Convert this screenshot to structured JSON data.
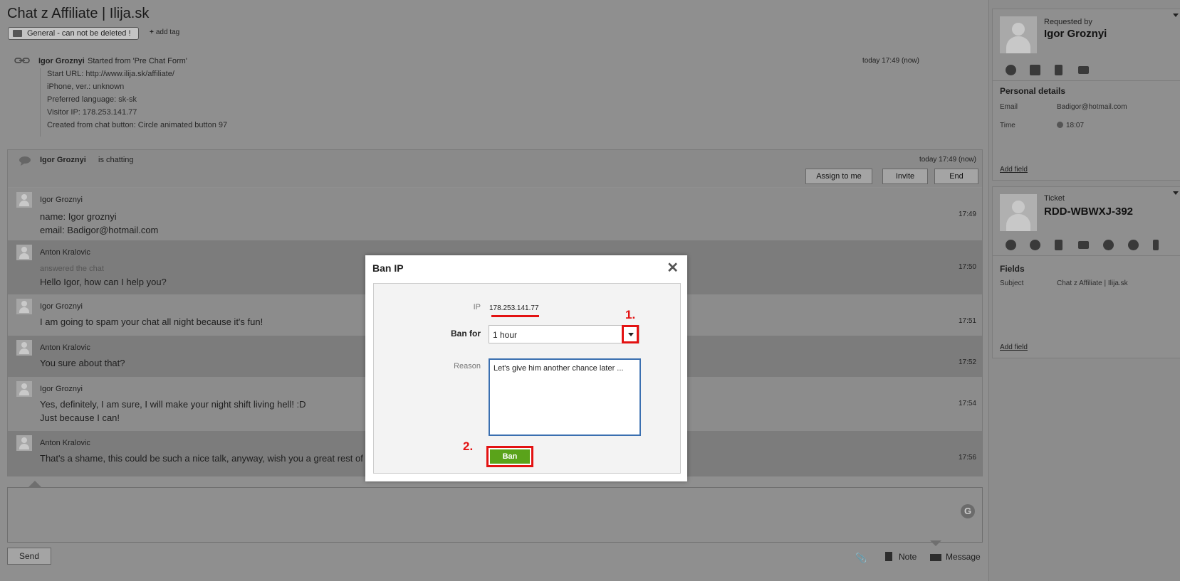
{
  "header": {
    "title": "Chat z Affiliate | Ilija.sk",
    "tag_label": "General - can not be deleted !",
    "add_tag": "add tag"
  },
  "start": {
    "name": "Igor Groznyi",
    "description": "Started from 'Pre Chat Form'",
    "time": "today 17:49 (now)",
    "details": [
      "Start URL: http://www.ilija.sk/affiliate/",
      "iPhone, ver.: unknown",
      "Preferred language: sk-sk",
      "Visitor IP: 178.253.141.77",
      "Created from chat button: Circle animated button 97"
    ]
  },
  "chat": {
    "name": "Igor Groznyi",
    "status": "is chatting",
    "time": "today 17:49 (now)",
    "buttons": {
      "assign": "Assign to me",
      "invite": "Invite",
      "end": "End"
    },
    "messages": [
      {
        "name": "Igor Groznyi",
        "lines": [
          "name: Igor groznyi",
          "email: Badigor@hotmail.com"
        ],
        "time": "17:49"
      },
      {
        "name": "Anton Kralovic",
        "sub": "answered the chat",
        "lines": [
          "Hello Igor, how can I help you?"
        ],
        "time": "17:50"
      },
      {
        "name": "Igor Groznyi",
        "lines": [
          "I am going to spam your chat all night because it's fun!"
        ],
        "time": "17:51"
      },
      {
        "name": "Anton Kralovic",
        "lines": [
          "You sure about that?"
        ],
        "time": "17:52"
      },
      {
        "name": "Igor Groznyi",
        "lines": [
          "Yes, definitely, I am sure, I will make your night shift living hell! :D",
          "Just because I can!"
        ],
        "time": "17:54"
      },
      {
        "name": "Anton Kralovic",
        "lines": [
          "That's a shame, this could be such a nice talk, anyway, wish you a great rest of"
        ],
        "time": "17:56"
      }
    ]
  },
  "composer": {
    "send": "Send",
    "note": "Note",
    "message": "Message"
  },
  "right": {
    "requested_by_label": "Requested by",
    "requester": "Igor Groznyi",
    "personal_details": "Personal details",
    "email_key": "Email",
    "email_val": "Badigor@hotmail.com",
    "time_key": "Time",
    "time_val": "18:07",
    "add_field": "Add field",
    "ticket_label": "Ticket",
    "ticket_id": "RDD-WBWXJ-392",
    "fields": "Fields",
    "subject_key": "Subject",
    "subject_val": "Chat z Affiliate | Ilija.sk",
    "add_field2": "Add field"
  },
  "modal": {
    "title": "Ban IP",
    "close": "✕",
    "ip_label": "IP",
    "ip_value": "178.253.141.77",
    "ban_for_label": "Ban for",
    "ban_for_value": "1 hour",
    "reason_label": "Reason",
    "reason_value": "Let's give him another chance later ...",
    "ban_button": "Ban",
    "annotation_1": "1.",
    "annotation_2": "2."
  },
  "colors": {
    "overlay": "#8f8f8f",
    "annotation_red": "#e31212",
    "ban_green": "#5aa31a"
  }
}
